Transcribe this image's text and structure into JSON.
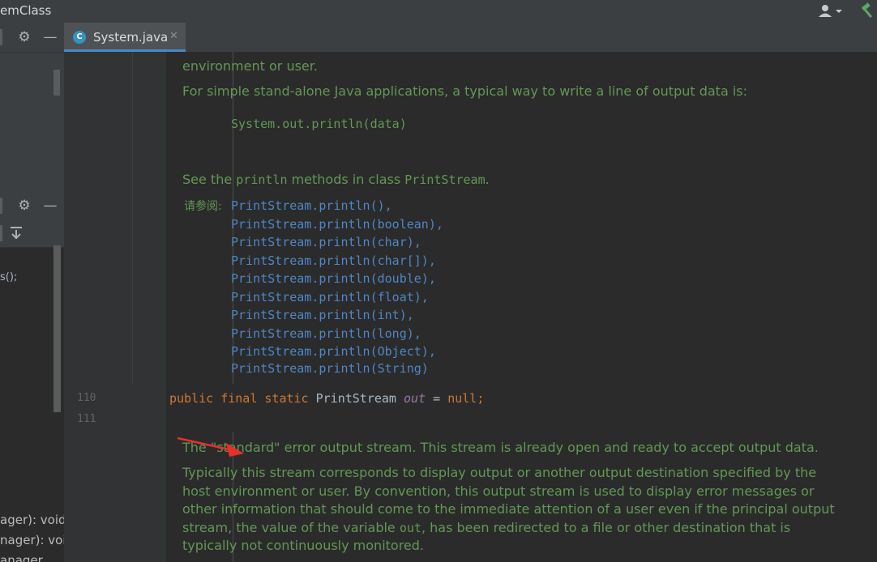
{
  "window": {
    "title_fragment": "emClass",
    "user_icon": "user-icon",
    "build_icon": "hammer-icon"
  },
  "left_panel": {
    "panel1_icons": [
      "gear-icon",
      "minus-icon"
    ],
    "panel2_icons": [
      "gear-icon",
      "minus-icon",
      "pin-down-icon"
    ],
    "code_fragment": "s();",
    "methods": [
      "ager): void",
      "nager): voi",
      "anager"
    ]
  },
  "tabs": [
    {
      "label": "System.java",
      "icon": "java-class-icon",
      "active": true
    }
  ],
  "editor": {
    "line_numbers": [
      "110",
      "111"
    ],
    "doc1": {
      "line_top_partial": "environment or user.",
      "para": "For simple stand-alone Java applications, a typical way to write a line of output data is:",
      "code_example": "System.out.println(data)",
      "see_prefix": "See the ",
      "see_code1": "println",
      "see_mid": " methods in class ",
      "see_code2": "PrintStream",
      "see_suffix": ".",
      "see_also_label": "请参阅:",
      "see_also_links": [
        "PrintStream.println()",
        "PrintStream.println(boolean)",
        "PrintStream.println(char)",
        "PrintStream.println(char[])",
        "PrintStream.println(double)",
        "PrintStream.println(float)",
        "PrintStream.println(int)",
        "PrintStream.println(long)",
        "PrintStream.println(Object)",
        "PrintStream.println(String)"
      ]
    },
    "code_line_110": {
      "kw1": "public",
      "kw2": "final",
      "kw3": "static",
      "type": "PrintStream",
      "field": "out",
      "op": "=",
      "value": "null",
      "semi": ";"
    },
    "doc2": {
      "para1": "The \"standard\" error output stream. This stream is already open and ready to accept output data.",
      "para2_line1": "Typically this stream corresponds to display output or another output destination specified by the",
      "para2_line2": "host environment or user. By convention, this output stream is used to display error messages or",
      "para2_line3": "other information that should come to the immediate attention of a user even if the principal output",
      "para2_line4a": "stream, the value of the variable ",
      "para2_line4code": "out",
      "para2_line4b": ", has been redirected to a file or other destination that is",
      "para2_line5": "typically not continuously monitored."
    },
    "colors": {
      "background": "#2b2b2b",
      "doc_text": "#629755",
      "link": "#4f86c5",
      "keyword": "#cc7832",
      "annotation_arrow": "#e8302a"
    }
  }
}
